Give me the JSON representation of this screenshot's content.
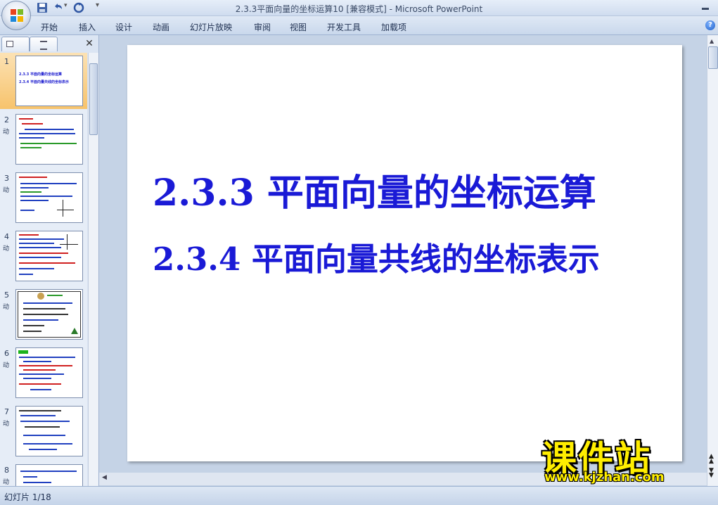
{
  "window": {
    "title": "2.3.3平面向量的坐标运算10 [兼容模式]",
    "app_name": " - Microsoft PowerPoint"
  },
  "quick_access": {
    "icons": [
      "save-icon",
      "undo-icon",
      "redo-icon",
      "customize-icon"
    ]
  },
  "ribbon": {
    "tabs": [
      "开始",
      "插入",
      "设计",
      "动画",
      "幻灯片放映",
      "审阅",
      "视图",
      "开发工具",
      "加载项"
    ]
  },
  "left_pane": {
    "slides": [
      {
        "num": "1",
        "anim": ""
      },
      {
        "num": "2",
        "anim": "动"
      },
      {
        "num": "3",
        "anim": "动"
      },
      {
        "num": "4",
        "anim": "动"
      },
      {
        "num": "5",
        "anim": "动"
      },
      {
        "num": "6",
        "anim": "动"
      },
      {
        "num": "7",
        "anim": "动"
      },
      {
        "num": "8",
        "anim": "动"
      }
    ],
    "slide1_thumb_lines": [
      "2.3.3  平面向量的坐标运算",
      "2.3.4  平面向量共线的坐标表示"
    ]
  },
  "slide": {
    "title_line1": "2.3.3  平面向量的坐标运算",
    "title_line2": "2.3.4  平面向量共线的坐标表示",
    "title_color": "#1a1ad6"
  },
  "status_bar": {
    "slide_count": "幻灯片 1/18"
  },
  "watermark": {
    "text": "课件站",
    "url": "www.kjzhan.com",
    "color": "#ffee00"
  }
}
